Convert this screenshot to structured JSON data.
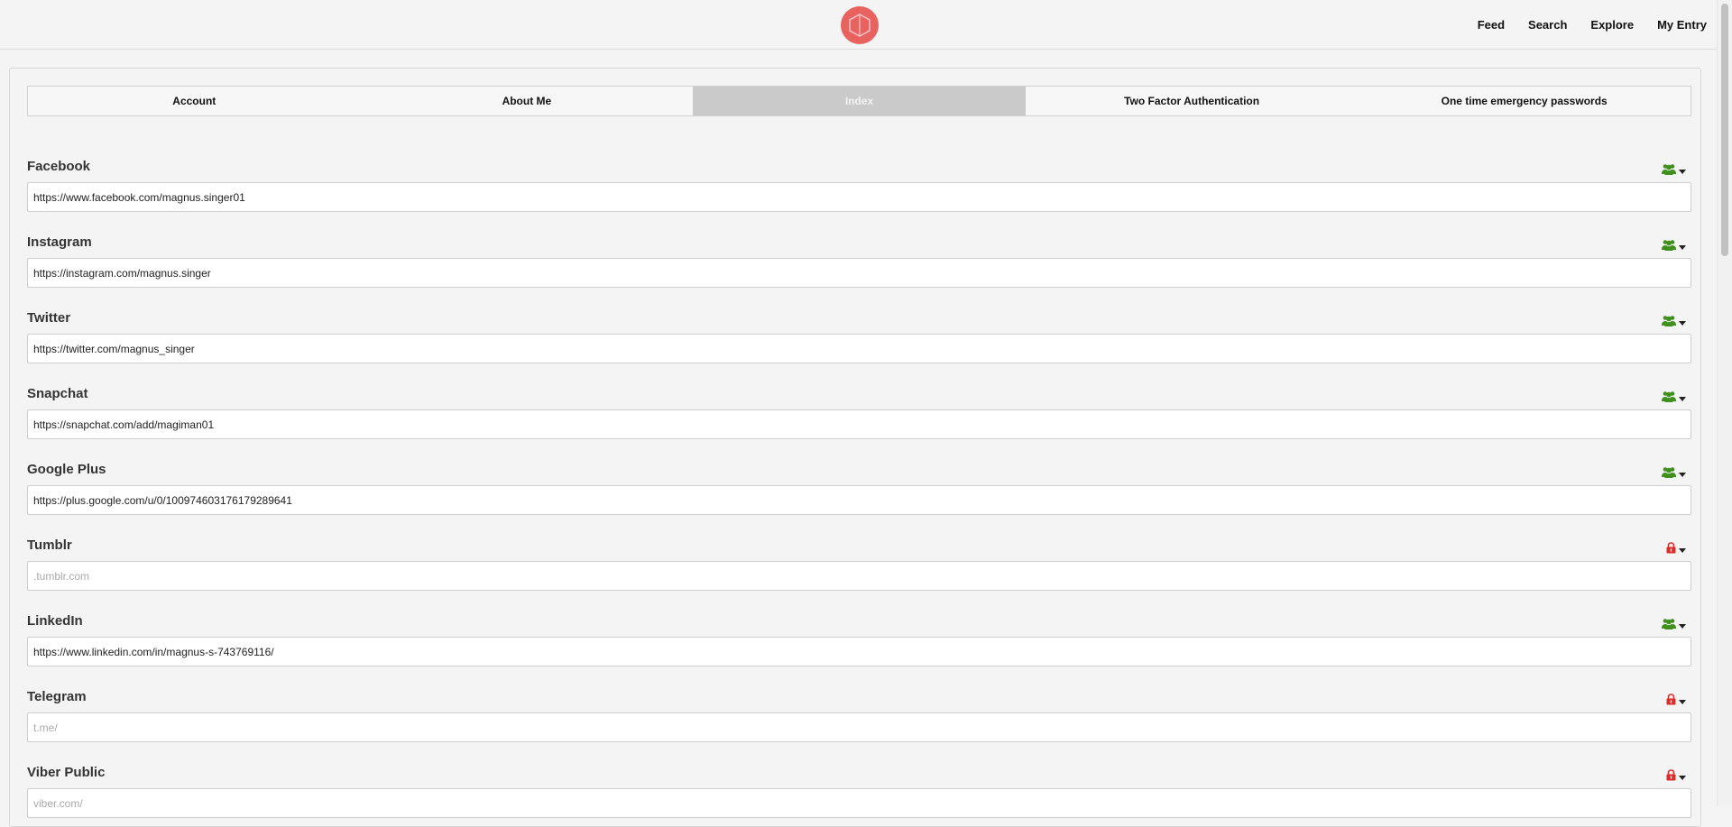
{
  "nav": {
    "links": [
      "Feed",
      "Search",
      "Explore",
      "My Entry"
    ]
  },
  "tabs": [
    {
      "label": "Account",
      "active": false
    },
    {
      "label": "About Me",
      "active": false
    },
    {
      "label": "Index",
      "active": true
    },
    {
      "label": "Two Factor Authentication",
      "active": false
    },
    {
      "label": "One time emergency passwords",
      "active": false
    }
  ],
  "colors": {
    "logo": "#e8625f",
    "public_icon": "#3e8f1c",
    "private_icon": "#e02b2b",
    "active_tab": "#cacaca"
  },
  "fields": [
    {
      "label": "Facebook",
      "value": "https://www.facebook.com/magnus.singer01",
      "placeholder": "",
      "privacy": "group-icon"
    },
    {
      "label": "Instagram",
      "value": "https://instagram.com/magnus.singer",
      "placeholder": "",
      "privacy": "group-icon"
    },
    {
      "label": "Twitter",
      "value": "https://twitter.com/magnus_singer",
      "placeholder": "",
      "privacy": "group-icon"
    },
    {
      "label": "Snapchat",
      "value": "https://snapchat.com/add/magiman01",
      "placeholder": "",
      "privacy": "group-icon"
    },
    {
      "label": "Google Plus",
      "value": "https://plus.google.com/u/0/100974603176179289641",
      "placeholder": "",
      "privacy": "group-icon"
    },
    {
      "label": "Tumblr",
      "value": "",
      "placeholder": ".tumblr.com",
      "privacy": "lock-icon"
    },
    {
      "label": "LinkedIn",
      "value": "https://www.linkedin.com/in/magnus-s-743769116/",
      "placeholder": "",
      "privacy": "group-icon"
    },
    {
      "label": "Telegram",
      "value": "",
      "placeholder": "t.me/",
      "privacy": "lock-icon"
    },
    {
      "label": "Viber Public",
      "value": "",
      "placeholder": "viber.com/",
      "privacy": "lock-icon"
    }
  ]
}
